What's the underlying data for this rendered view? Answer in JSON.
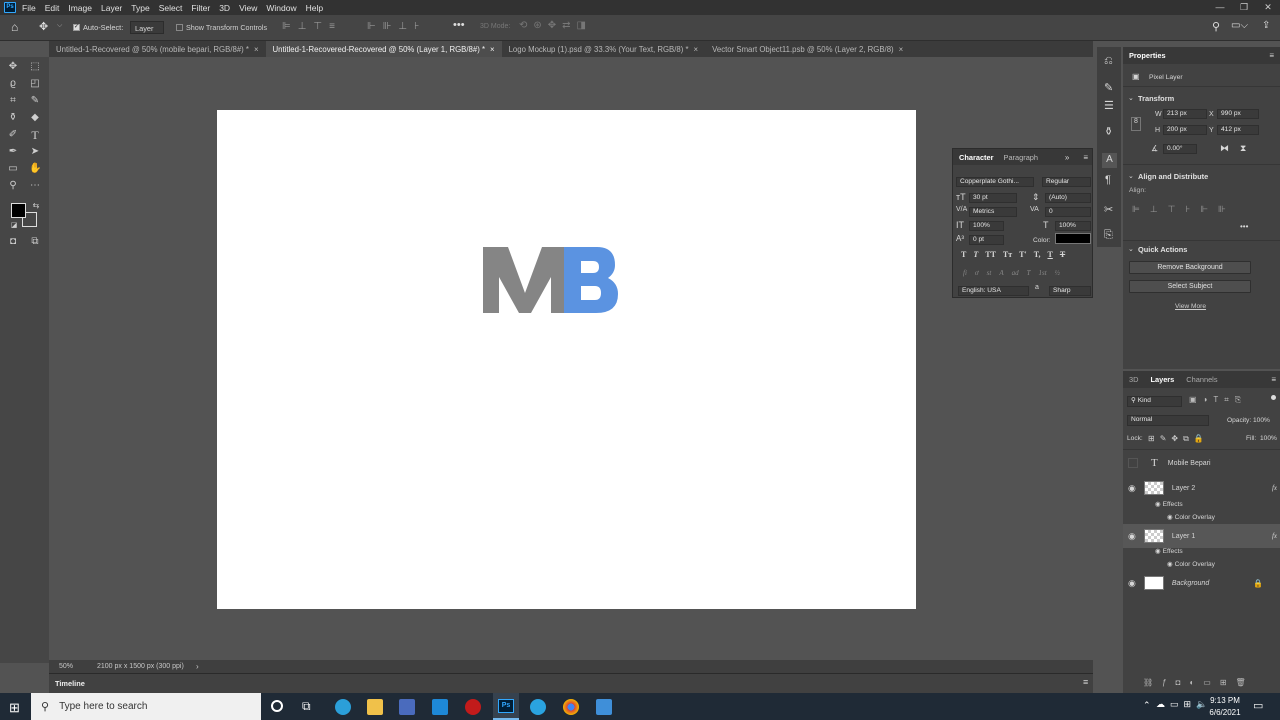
{
  "menu": {
    "items": [
      "File",
      "Edit",
      "Image",
      "Layer",
      "Type",
      "Select",
      "Filter",
      "3D",
      "View",
      "Window",
      "Help"
    ]
  },
  "options": {
    "auto_select": "Auto-Select:",
    "auto_select_target": "Layer",
    "show_transform": "Show Transform Controls",
    "mode_3d": "3D Mode:"
  },
  "tabs": [
    {
      "label": "Untitled-1-Recovered @ 50% (mobile bepari, RGB/8#) *"
    },
    {
      "label": "Untitled-1-Recovered-Recovered @ 50% (Layer 1, RGB/8#) *"
    },
    {
      "label": "Logo Mockup (1).psd @ 33.3% (Your Text, RGB/8) *"
    },
    {
      "label": "Vector Smart Object11.psb @ 50% (Layer 2, RGB/8)"
    }
  ],
  "logo": {
    "m": "M",
    "b": "B",
    "m_color": "#858585",
    "b_color": "#5b93e1"
  },
  "status": {
    "zoom": "50%",
    "doc_size": "2100 px x 1500 px (300 ppi)"
  },
  "timeline": {
    "label": "Timeline"
  },
  "character": {
    "tab1": "Character",
    "tab2": "Paragraph",
    "font": "Copperplate Gothi...",
    "style": "Regular",
    "size": "30 pt",
    "leading": "(Auto)",
    "kerning": "Metrics",
    "tracking": "0",
    "vscale": "100%",
    "hscale": "100%",
    "baseline": "0 pt",
    "color_label": "Color:",
    "language": "English: USA",
    "aa_a": "a",
    "antialias": "Sharp",
    "type_glyphs": [
      "T",
      "T",
      "TT",
      "Tт",
      "T'",
      "T,",
      "T",
      "T"
    ],
    "ot_glyphs": [
      "fi",
      "ơ",
      "st",
      "A",
      "ad",
      "T",
      "1st",
      "½"
    ]
  },
  "properties": {
    "title": "Properties",
    "kind": "Pixel Layer",
    "transform": "Transform",
    "w_label": "W",
    "w": "213 px",
    "h_label": "H",
    "h": "200 px",
    "x_label": "X",
    "x": "990 px",
    "y_label": "Y",
    "y": "412 px",
    "angle": "0.00°",
    "align_title": "Align and Distribute",
    "align_label": "Align:",
    "quick_actions": "Quick Actions",
    "remove_bg": "Remove Background",
    "select_subject": "Select Subject",
    "view_more": "View More"
  },
  "layers_panel": {
    "tab_3d": "3D",
    "tab_layers": "Layers",
    "tab_channels": "Channels",
    "kind": "Kind",
    "blend": "Normal",
    "opacity_label": "Opacity:",
    "opacity": "100%",
    "lock_label": "Lock:",
    "fill_label": "Fill:",
    "fill": "100%",
    "layers": [
      {
        "name": "Mobile Bepari"
      },
      {
        "name": "Layer 2",
        "effects": "Effects",
        "effect": "Color Overlay",
        "fx": "fx"
      },
      {
        "name": "Layer 1",
        "effects": "Effects",
        "effect": "Color Overlay",
        "fx": "fx"
      },
      {
        "name": "Background"
      }
    ]
  },
  "taskbar": {
    "search": "Type here to search",
    "time": "9:13 PM",
    "date": "6/6/2021"
  }
}
